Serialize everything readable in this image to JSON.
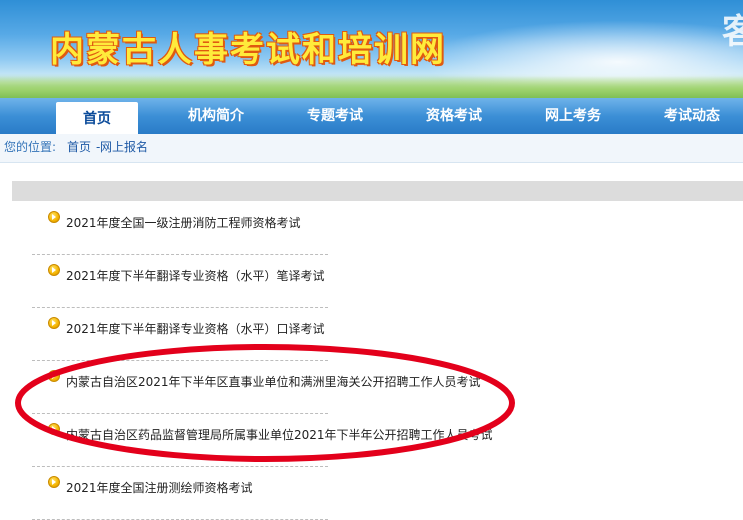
{
  "banner": {
    "site_title": "内蒙古人事考试和培训网",
    "corner_char": "客"
  },
  "nav": {
    "items": [
      {
        "label": "首页"
      },
      {
        "label": "机构简介"
      },
      {
        "label": "专题考试"
      },
      {
        "label": "资格考试"
      },
      {
        "label": "网上考务"
      },
      {
        "label": "考试动态"
      }
    ],
    "active_index": 0
  },
  "breadcrumb": {
    "label": "您的位置:",
    "home": "首页",
    "separator": "-",
    "current": "网上报名"
  },
  "list": {
    "items": [
      {
        "title": "2021年度全国一级注册消防工程师资格考试"
      },
      {
        "title": "2021年度下半年翻译专业资格（水平）笔译考试"
      },
      {
        "title": "2021年度下半年翻译专业资格（水平）口译考试"
      },
      {
        "title": "内蒙古自治区2021年下半年区直事业单位和满洲里海关公开招聘工作人员考试"
      },
      {
        "title": "内蒙古自治区药品监督管理局所属事业单位2021年下半年公开招聘工作人员考试"
      },
      {
        "title": "2021年度全国注册测绘师资格考试"
      }
    ]
  },
  "colors": {
    "nav_blue": "#3c8fd6",
    "title_yellow": "#ffeb3b",
    "annotation_red": "#e3001b"
  }
}
